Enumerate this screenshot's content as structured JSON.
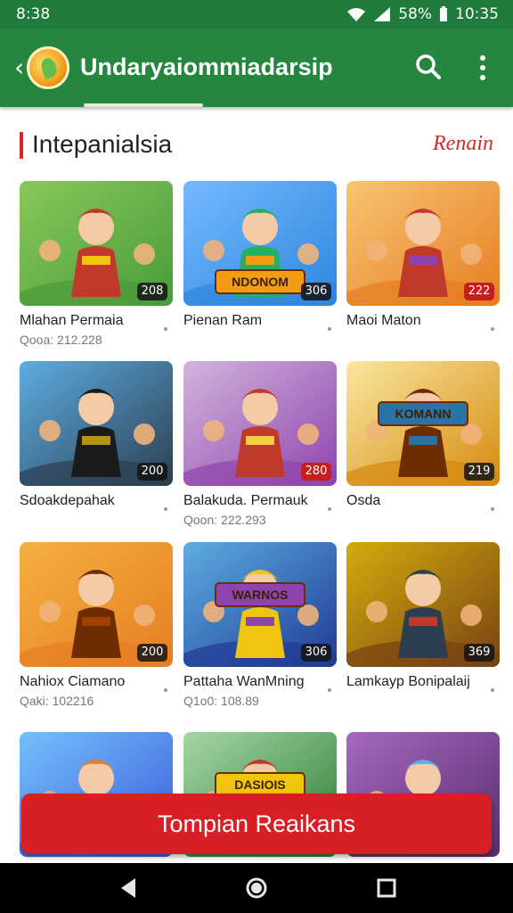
{
  "status": {
    "time_left": "8:38",
    "battery": "58%",
    "time_right": "10:35"
  },
  "appbar": {
    "title": "Undaryaiommiadarsip",
    "back_glyph": "‹"
  },
  "section": {
    "title": "Intepanialsia",
    "more_link": "Renain"
  },
  "cards": [
    {
      "name": "Mlahan Permaia",
      "meta": "Qooa: 212.228",
      "badge": "208",
      "art": "green-warrior"
    },
    {
      "name": "Pienan Ram",
      "meta": "",
      "badge": "306",
      "art": "hero-boy",
      "banner": "NDONOM"
    },
    {
      "name": "Maoi Maton",
      "meta": "",
      "badge": "222",
      "art": "girl-squad"
    },
    {
      "name": "Sdoakdepahak",
      "meta": "",
      "badge": "200",
      "art": "dark-knight"
    },
    {
      "name": "Balakuda. Permauk",
      "meta": "Qoon: 222.293",
      "badge": "280",
      "art": "golden-armor"
    },
    {
      "name": "Osda",
      "meta": "",
      "badge": "219",
      "art": "temple-logo",
      "banner": "KOMANN"
    },
    {
      "name": "Nahiox Ciamano",
      "meta": "Qaki: 102216",
      "badge": "200",
      "art": "fire-warrior"
    },
    {
      "name": "Pattaha WanMning",
      "meta": "Q1o0: 108.89",
      "badge": "306",
      "art": "blue-team",
      "banner": "WARNOS"
    },
    {
      "name": "Lamkayp Bonipalaij",
      "meta": "",
      "badge": "369",
      "art": "pirate-duo"
    },
    {
      "name": "",
      "meta": "",
      "badge": "",
      "art": "sword-boy"
    },
    {
      "name": "",
      "meta": "",
      "badge": "",
      "art": "jungle-logo",
      "banner": "DASIOIS"
    },
    {
      "name": "",
      "meta": "",
      "badge": "",
      "art": "purple-mage"
    }
  ],
  "cta": {
    "label": "Tompian Reaikans"
  },
  "colors": {
    "appbar": "#25863f",
    "accent": "#d42a2a",
    "cta": "#d71f25"
  },
  "icons": {
    "search": "search-icon",
    "menu": "overflow-menu-icon",
    "back": "back-arrow-icon"
  }
}
